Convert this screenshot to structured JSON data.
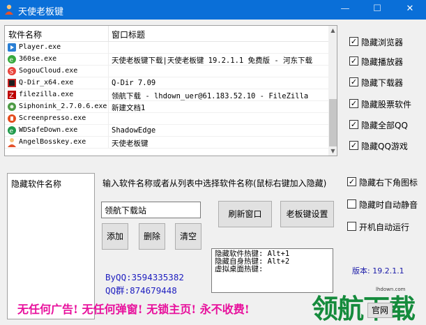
{
  "window": {
    "title": "天使老板键",
    "minimize": "—",
    "maximize": "☐",
    "close": "✕"
  },
  "process_list": {
    "columns": [
      "软件名称",
      "窗口标题"
    ],
    "rows": [
      {
        "name": "Player.exe",
        "title": "",
        "icon": "player-icon"
      },
      {
        "name": "360se.exe",
        "title": "天使老板键下载|天使老板键 19.2.1.1 免费版 - 河东下载",
        "icon": "360se-icon"
      },
      {
        "name": "SogouCloud.exe",
        "title": "",
        "icon": "sogou-icon"
      },
      {
        "name": "Q-Dir_x64.exe",
        "title": "Q-Dir 7.09",
        "icon": "qdir-icon"
      },
      {
        "name": "filezilla.exe",
        "title": "领航下载 - lhdown_uer@61.183.52.10 - FileZilla",
        "icon": "filezilla-icon"
      },
      {
        "name": "Siphonink_2.7.0.6.exe",
        "title": "新建文档1",
        "icon": "siphonink-icon"
      },
      {
        "name": "Screenpresso.exe",
        "title": "",
        "icon": "screenpresso-icon"
      },
      {
        "name": "WDSafeDown.exe",
        "title": "ShadowEdge",
        "icon": "wdsafedown-icon"
      },
      {
        "name": "AngelBosskey.exe",
        "title": "天使老板键",
        "icon": "angelbosskey-icon"
      }
    ]
  },
  "options_top": [
    {
      "label": "隐藏浏览器",
      "checked": true
    },
    {
      "label": "隐藏播放器",
      "checked": true
    },
    {
      "label": "隐藏下载器",
      "checked": true
    },
    {
      "label": "隐藏股票软件",
      "checked": true
    },
    {
      "label": "隐藏全部QQ",
      "checked": true
    },
    {
      "label": "隐藏QQ游戏",
      "checked": true
    }
  ],
  "options_bottom": [
    {
      "label": "隐藏右下角图标",
      "checked": true
    },
    {
      "label": "隐藏时自动静音",
      "checked": false
    },
    {
      "label": "开机自动运行",
      "checked": false
    }
  ],
  "hidden_list": {
    "title": "隐藏软件名称"
  },
  "instruction": "输入软件名称或者从列表中选择软件名称(鼠标右键加入隐藏)",
  "name_input": {
    "value": "领航下载站"
  },
  "buttons": {
    "add": "添加",
    "delete": "删除",
    "clear": "清空",
    "refresh": "刷新窗口",
    "settings": "老板键设置",
    "site": "官网"
  },
  "hotkeys": [
    "隐藏软件热键: Alt+1",
    "隐藏自身热键: Alt+2",
    "虚拟桌面热键:"
  ],
  "contact": {
    "qq": "ByQQ:3594335382",
    "qq_group": "QQ群:874679448"
  },
  "version": "版本: 19.2.1.1",
  "slogan": "无任何广告! 无任何弹窗! 无锁主页! 永不收费!",
  "watermark": {
    "text": "领航下载",
    "site": "lhdown.com"
  },
  "colors": {
    "titlebar": "#0a6fd8",
    "slogan": "#e8109c",
    "contact": "#2020c0",
    "watermark": "#158b3c"
  }
}
